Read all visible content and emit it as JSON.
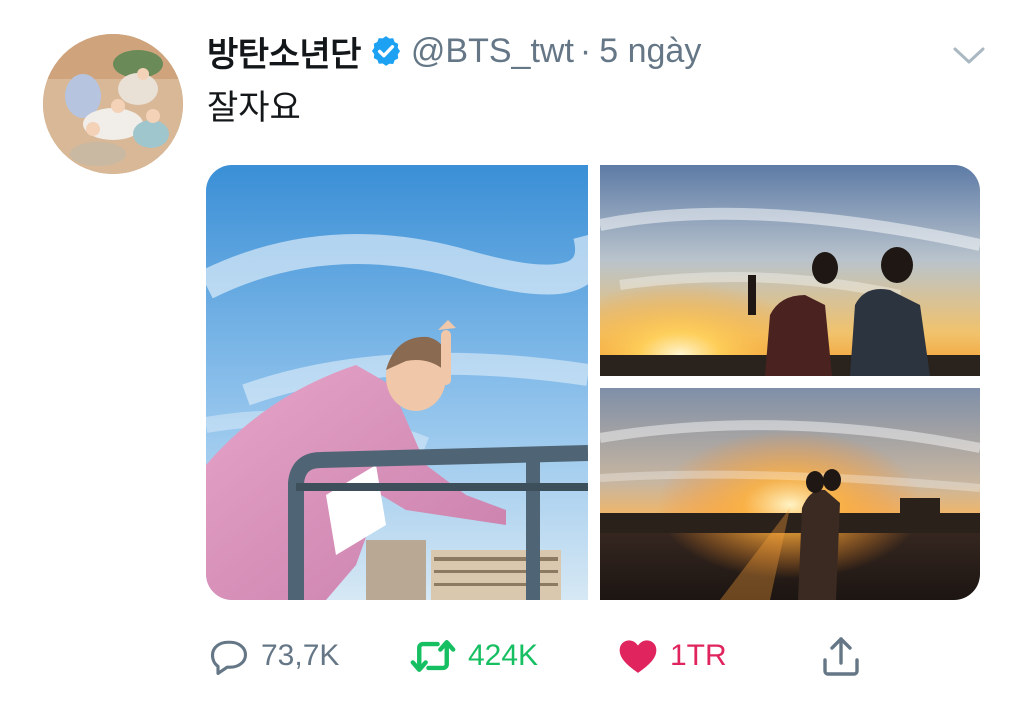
{
  "tweet": {
    "display_name": "방탄소년단",
    "handle": "@BTS_twt",
    "separator": "·",
    "time": "5 ngày",
    "text": "잘자요",
    "verified": true
  },
  "actions": {
    "replies": "73,7K",
    "retweets": "424K",
    "likes": "1TR"
  },
  "icons": {
    "verified": "verified-badge-icon",
    "caret": "chevron-down-icon",
    "reply": "speech-bubble-icon",
    "retweet": "retweet-arrows-icon",
    "like": "heart-icon",
    "share": "share-upload-icon"
  },
  "colors": {
    "verified_blue": "#1da1f2",
    "retweet_green": "#17bf63",
    "like_red": "#e0245e",
    "muted_gray": "#657786",
    "text": "#14171a"
  }
}
